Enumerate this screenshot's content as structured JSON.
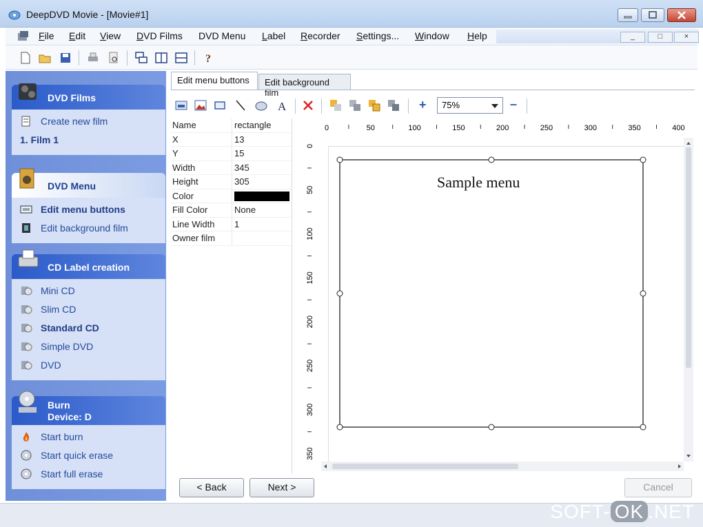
{
  "window": {
    "title": "DeepDVD Movie - [Movie#1]"
  },
  "menubar": {
    "items": [
      "File",
      "Edit",
      "View",
      "DVD Films",
      "DVD Menu",
      "Label",
      "Recorder",
      "Settings...",
      "Window",
      "Help"
    ],
    "mdi_buttons": [
      "_",
      "□",
      "×"
    ]
  },
  "toolbar": {
    "icons": [
      "new-icon",
      "open-icon",
      "save-icon",
      "print-icon",
      "print-preview-icon",
      "cascade-icon",
      "tile-vertical-icon",
      "tile-horizontal-icon",
      "help-icon"
    ]
  },
  "sidebar": {
    "groups": [
      {
        "title": "DVD Films",
        "icon": "film-reel-icon",
        "items": [
          {
            "label": "Create new film",
            "icon": "document-icon",
            "bold": false
          },
          {
            "label": "1. Film 1",
            "icon": "",
            "bold": true
          }
        ]
      },
      {
        "title": "DVD Menu",
        "icon": "menu-folder-icon",
        "items": [
          {
            "label": "Edit menu buttons",
            "icon": "menu-edit-icon",
            "bold": true
          },
          {
            "label": "Edit background film",
            "icon": "film-icon",
            "bold": false
          }
        ]
      },
      {
        "title": "CD Label creation",
        "icon": "printer-icon",
        "items": [
          {
            "label": "Mini CD",
            "icon": "cd-label-icon",
            "bold": false
          },
          {
            "label": "Slim CD",
            "icon": "cd-label-icon",
            "bold": false
          },
          {
            "label": "Standard CD",
            "icon": "cd-label-icon",
            "bold": true
          },
          {
            "label": "Simple DVD",
            "icon": "cd-label-icon",
            "bold": false
          },
          {
            "label": "DVD",
            "icon": "cd-label-icon",
            "bold": false
          }
        ]
      },
      {
        "title": "Burn",
        "subtitle": "Device: D",
        "icon": "burner-icon",
        "items": [
          {
            "label": "Start burn",
            "icon": "flame-icon",
            "bold": false
          },
          {
            "label": "Start quick erase",
            "icon": "disc-icon",
            "bold": false
          },
          {
            "label": "Start full erase",
            "icon": "disc-icon",
            "bold": false
          }
        ]
      }
    ]
  },
  "tabs": [
    {
      "label": "Edit menu buttons",
      "active": true
    },
    {
      "label": "Edit background film",
      "active": false
    }
  ],
  "editor_toolbar": {
    "zoom": "75%",
    "plus": "+",
    "minus": "–"
  },
  "properties": [
    {
      "key": "Name",
      "value": "rectangle"
    },
    {
      "key": "X",
      "value": "13"
    },
    {
      "key": "Y",
      "value": "15"
    },
    {
      "key": "Width",
      "value": "345"
    },
    {
      "key": "Height",
      "value": "305"
    },
    {
      "key": "Color",
      "value": "",
      "swatch": "#000000"
    },
    {
      "key": "Fill Color",
      "value": "None"
    },
    {
      "key": "Line Width",
      "value": "1"
    },
    {
      "key": "Owner film",
      "value": ""
    }
  ],
  "rulers": {
    "h_labels": [
      "0",
      "50",
      "100",
      "150",
      "200",
      "250",
      "300",
      "350",
      "400"
    ],
    "v_labels": [
      "0",
      "50",
      "100",
      "150",
      "200",
      "250",
      "300",
      "350"
    ]
  },
  "canvas": {
    "sample_text": "Sample menu"
  },
  "buttons": {
    "back": "< Back",
    "next": "Next >",
    "cancel": "Cancel"
  },
  "watermark": {
    "left": "SOFT-",
    "mid": "OK",
    "right": ".NET"
  }
}
